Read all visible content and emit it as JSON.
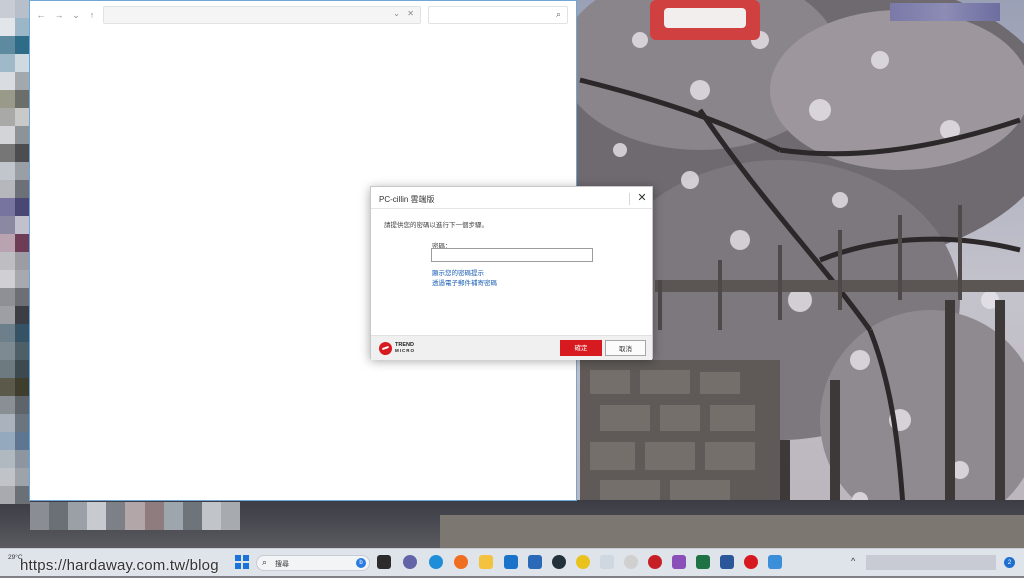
{
  "dialog": {
    "title": "PC-cillin 雲端版",
    "close_glyph": "✕",
    "message": "請提供您的密碼以進行下一個步驟。",
    "password_label": "密碼：",
    "password_value": "",
    "link_show_hint": "顯示您的密碼提示",
    "link_reset_email": "透過電子郵件補寄密碼",
    "ok_label": "確定",
    "cancel_label": "取消",
    "logo_text_1": "TREND",
    "logo_text_2": "MICRO",
    "brand_color": "#d71920"
  },
  "explorer": {
    "back_glyph": "←",
    "forward_glyph": "→",
    "recent_glyph": "⌄",
    "up_glyph": "↑",
    "address_value": "",
    "search_value": ""
  },
  "taskbar": {
    "weather_text": "29°C",
    "watermark": "https://hardaway.com.tw/blog",
    "search_label": "搜尋",
    "bing_label": "b",
    "notification_count": "2",
    "icons": [
      "windows-start-icon",
      "task-view-icon",
      "teams-chat-icon",
      "edge-icon",
      "firefox-icon",
      "file-explorer-icon",
      "mail-icon",
      "store-icon",
      "chrome-icon",
      "norton-icon",
      "photos-icon",
      "search-tool-icon",
      "antivirus-icon",
      "app-icon",
      "excel-icon",
      "word-icon",
      "trend-micro-icon",
      "paint-icon"
    ]
  }
}
